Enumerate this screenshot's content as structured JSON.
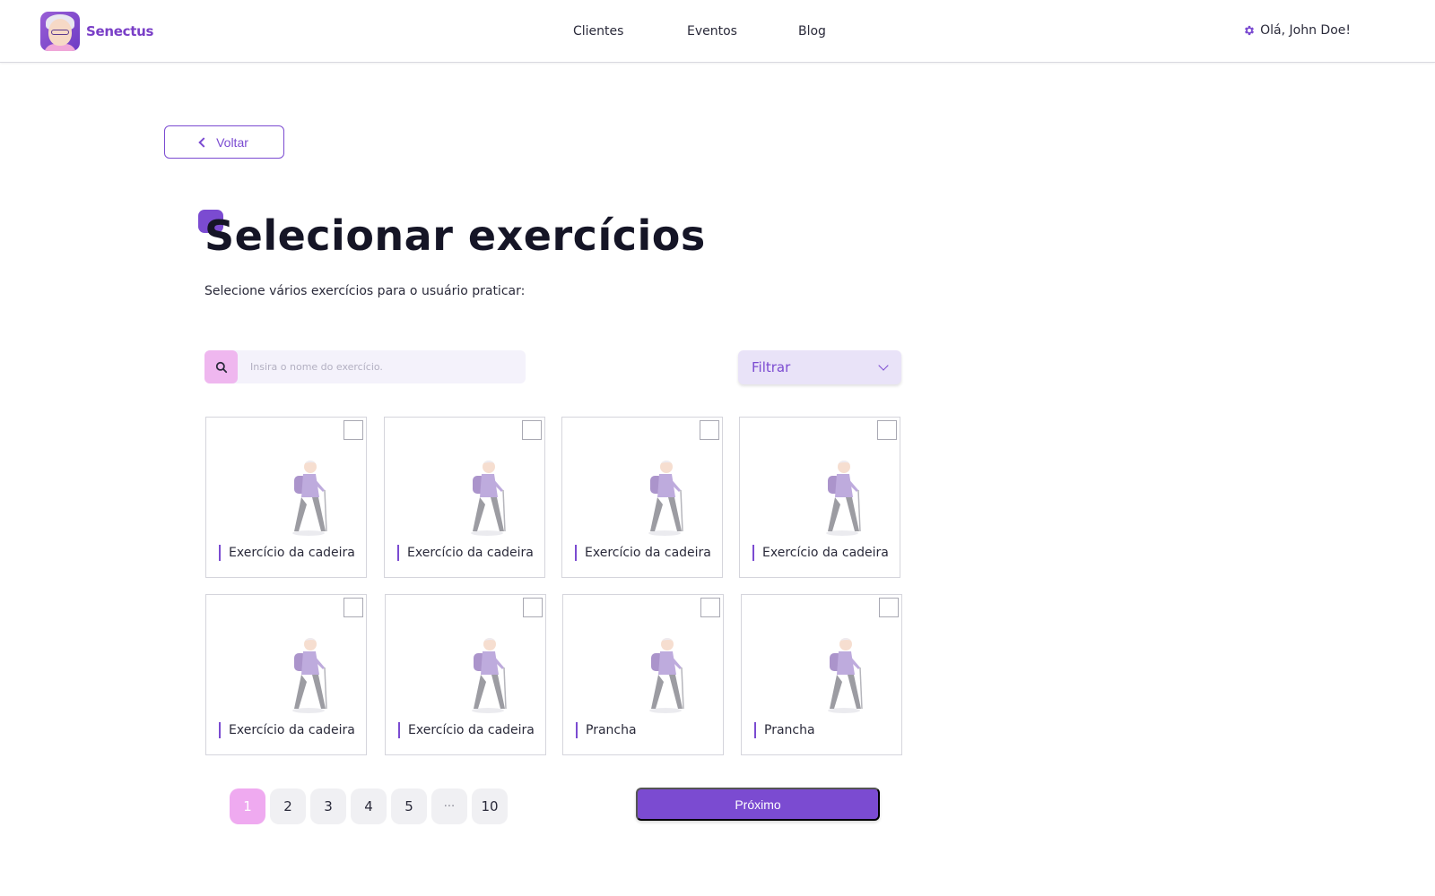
{
  "brand": {
    "name": "Senectus"
  },
  "nav": {
    "clientes": "Clientes",
    "eventos": "Eventos",
    "blog": "Blog"
  },
  "user": {
    "greeting": "Olá, John Doe!"
  },
  "back": {
    "label": "Voltar"
  },
  "page": {
    "title": "Selecionar exercícios",
    "subtitle": "Selecione vários exercícios para o usuário praticar:"
  },
  "search": {
    "placeholder": "Insira o nome do exercício."
  },
  "filter": {
    "label": "Filtrar"
  },
  "cards": [
    {
      "label": "Exercício da cadeira"
    },
    {
      "label": "Exercício da cadeira"
    },
    {
      "label": "Exercício da cadeira"
    },
    {
      "label": "Exercício da cadeira"
    },
    {
      "label": "Exercício da cadeira"
    },
    {
      "label": "Exercício da cadeira"
    },
    {
      "label": "Prancha"
    },
    {
      "label": "Prancha"
    }
  ],
  "pagination": {
    "pages": [
      "1",
      "2",
      "3",
      "4",
      "5",
      "···",
      "10"
    ],
    "current": "1"
  },
  "next": {
    "label": "Próximo"
  },
  "colors": {
    "accent": "#7b4bd1",
    "pink": "#efaaf0",
    "lavender": "#e9e3f8"
  },
  "icons": {
    "settings": "gear-icon",
    "search": "search-icon",
    "back": "chevron-left-icon",
    "filter": "chevron-down-icon"
  }
}
